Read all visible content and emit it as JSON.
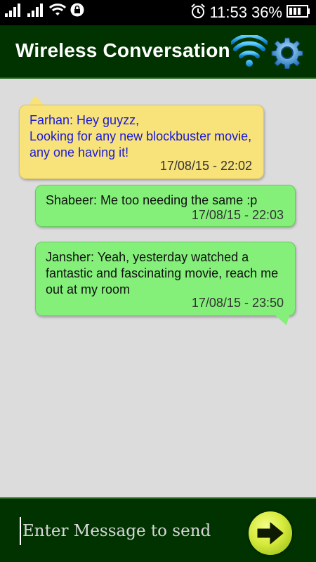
{
  "status_bar": {
    "time": "11:53",
    "battery": "36%",
    "icons": [
      "signal-icon",
      "signal-icon",
      "wifi-icon",
      "lock-icon",
      "alarm-icon",
      "battery-icon"
    ]
  },
  "header": {
    "title": "Wireless Conversation",
    "icons": [
      "wifi-icon",
      "gear-icon"
    ]
  },
  "messages": [
    {
      "text": "Farhan: Hey guyzz,\nLooking for any new blockbuster movie, any one having it!",
      "time": "17/08/15 - 22:02",
      "color": "#f8e27a",
      "text_color": "#1b1bd8"
    },
    {
      "text": "Shabeer: Me too needing the same :p",
      "time": "17/08/15 - 22:03",
      "color": "#84f07a",
      "text_color": "#111111"
    },
    {
      "text": "Jansher: Yeah, yesterday watched a fantastic and fascinating movie, reach me out at my room",
      "time": "17/08/15 - 23:50",
      "color": "#84f07a",
      "text_color": "#111111"
    }
  ],
  "input": {
    "placeholder": "Enter Message to send",
    "value": ""
  },
  "send_button": {
    "icon": "arrow-right-icon"
  },
  "colors": {
    "header_bg": "#013300",
    "chat_bg": "#dcdcdc",
    "accent_wifi": "#1aa0e8"
  }
}
